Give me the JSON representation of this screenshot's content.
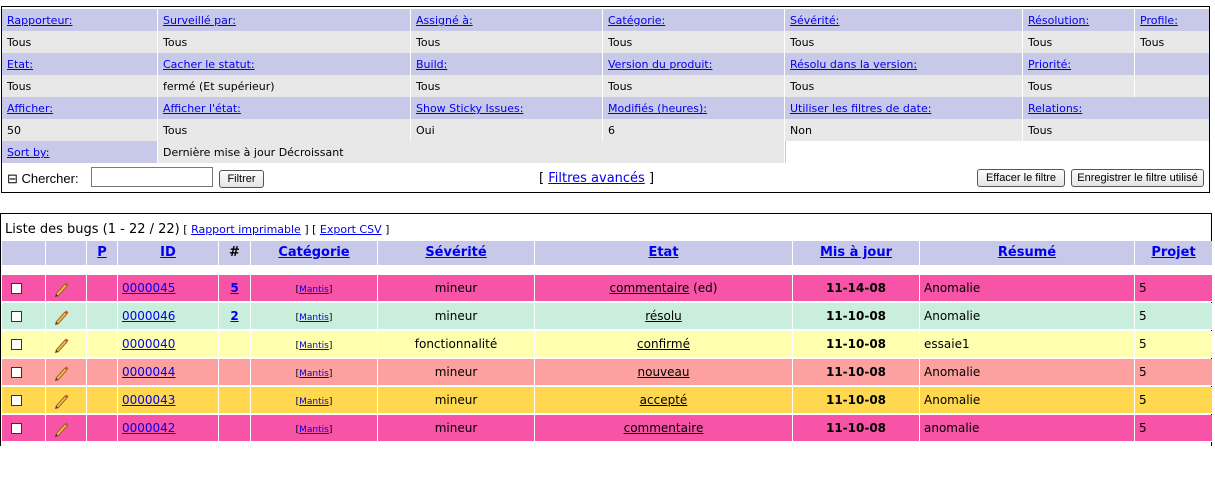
{
  "filters": {
    "row1": [
      "Rapporteur:",
      "Surveillé par:",
      "Assigné à:",
      "Catégorie:",
      "Sévérité:",
      "Résolution:",
      "Profile:"
    ],
    "row2": [
      "Tous",
      "Tous",
      "Tous",
      "Tous",
      "Tous",
      "Tous",
      "Tous"
    ],
    "row3": [
      "Etat:",
      "Cacher le statut:",
      "Build:",
      "Version du produit:",
      "Résolu dans la version:",
      "Priorité:",
      ""
    ],
    "row4": [
      "Tous",
      "fermé (Et supérieur)",
      "Tous",
      "Tous",
      "Tous",
      "Tous",
      ""
    ],
    "row5": [
      "Afficher:",
      "Afficher l'état:",
      "Show Sticky Issues:",
      "Modifiés (heures):",
      "Utiliser les filtres de date:",
      "Relations:"
    ],
    "row6": [
      "50",
      "Tous",
      "Oui",
      "6",
      "Non",
      "Tous"
    ],
    "sort_label": "Sort by:",
    "sort_value": "Dernière mise à jour Décroissant",
    "search_label": "⊟ Chercher:",
    "search_value": "",
    "filter_button": "Filtrer",
    "advanced_prefix": "[ ",
    "advanced_label": "Filtres avancés",
    "advanced_suffix": " ]",
    "clear_button": "Effacer le filtre",
    "save_button": "Enregistrer le filtre utilisé"
  },
  "list": {
    "title": "Liste des bugs (1 - 22 / 22)",
    "open_bracket_1": " [ ",
    "print_link": "Rapport imprimable",
    "mid_bracket": " ] [ ",
    "csv_link": "Export CSV",
    "close_bracket": " ]",
    "columns": {
      "p": "P",
      "id": "ID",
      "count": "#",
      "category": "Catégorie",
      "severity": "Sévérité",
      "status": "Etat",
      "updated": "Mis à jour",
      "summary": "Résumé",
      "project": "Projet"
    },
    "rows": [
      {
        "id": "0000045",
        "count": "5",
        "category": "Mantis",
        "severity": "mineur",
        "status": "commentaire",
        "status_extra": " (ed)",
        "updated": "11-14-08",
        "summary": "Anomalie",
        "project": "5",
        "color": "#f754a8"
      },
      {
        "id": "0000046",
        "count": "2",
        "category": "Mantis",
        "severity": "mineur",
        "status": "résolu",
        "status_extra": "",
        "updated": "11-10-08",
        "summary": "Anomalie",
        "project": "5",
        "color": "#c9eedc"
      },
      {
        "id": "0000040",
        "count": "",
        "category": "Mantis",
        "severity": "fonctionnalité",
        "status": "confirmé",
        "status_extra": "",
        "updated": "11-10-08",
        "summary": "essaie1",
        "project": "5",
        "color": "#ffffb0"
      },
      {
        "id": "0000044",
        "count": "",
        "category": "Mantis",
        "severity": "mineur",
        "status": "nouveau",
        "status_extra": "",
        "updated": "11-10-08",
        "summary": "Anomalie",
        "project": "5",
        "color": "#fca19f"
      },
      {
        "id": "0000043",
        "count": "",
        "category": "Mantis",
        "severity": "mineur",
        "status": "accepté",
        "status_extra": "",
        "updated": "11-10-08",
        "summary": "Anomalie",
        "project": "5",
        "color": "#ffd850"
      },
      {
        "id": "0000042",
        "count": "",
        "category": "Mantis",
        "severity": "mineur",
        "status": "commentaire",
        "status_extra": "",
        "updated": "11-10-08",
        "summary": "anomalie",
        "project": "5",
        "color": "#f754a8"
      }
    ]
  },
  "colors": {
    "header_bg": "#c8c8e8",
    "value_bg": "#e8e8e8"
  },
  "icons": {
    "edit": "pencil-icon",
    "select": "checkbox"
  }
}
